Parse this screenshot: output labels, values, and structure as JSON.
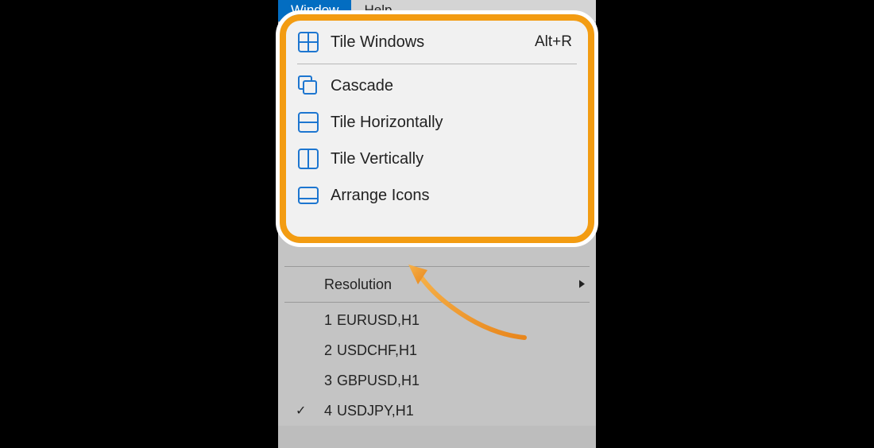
{
  "menubar": {
    "window": "Window",
    "help": "Help"
  },
  "highlight": {
    "tile_windows": "Tile Windows",
    "tile_windows_shortcut": "Alt+R",
    "cascade": "Cascade",
    "tile_horizontally": "Tile Horizontally",
    "tile_vertically": "Tile Vertically",
    "arrange_icons": "Arrange Icons"
  },
  "dropdown": {
    "resolution": "Resolution",
    "windows": [
      {
        "num": "1",
        "label": "EURUSD,H1",
        "checked": false
      },
      {
        "num": "2",
        "label": "USDCHF,H1",
        "checked": false
      },
      {
        "num": "3",
        "label": "GBPUSD,H1",
        "checked": false
      },
      {
        "num": "4",
        "label": "USDJPY,H1",
        "checked": true
      }
    ]
  }
}
